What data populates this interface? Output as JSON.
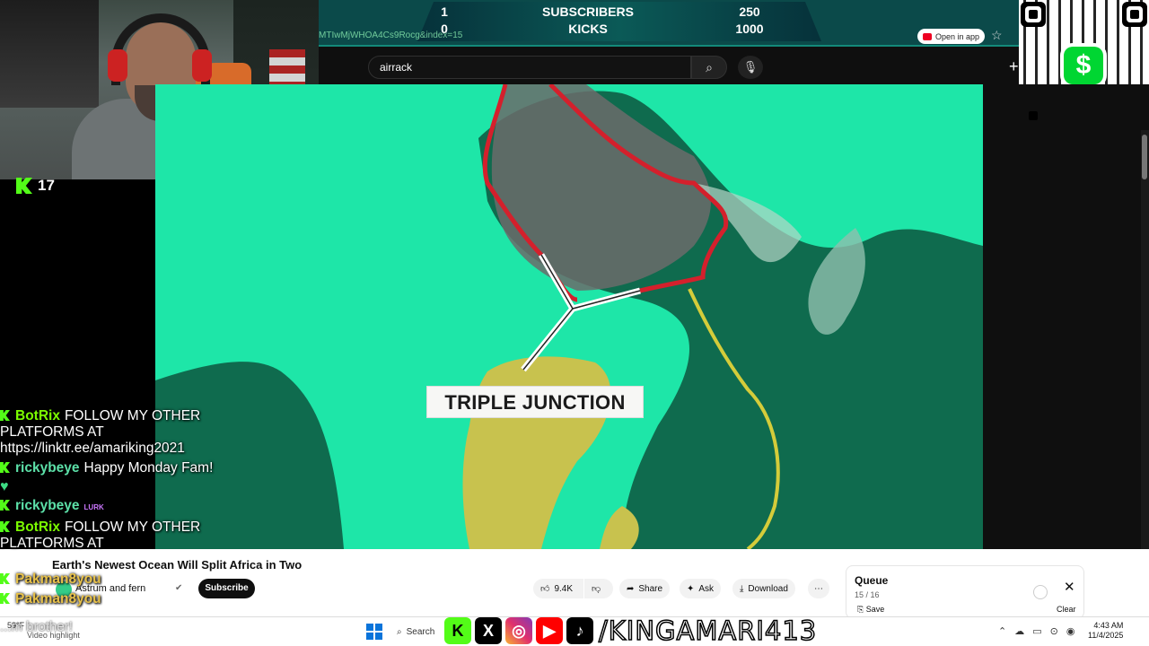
{
  "stream": {
    "kick_viewers": "17"
  },
  "goals": {
    "url_fragment": "MTIwMjWHOA4Cs9Rocg&index=15",
    "rows": [
      {
        "current": "1",
        "name": "SUBSCRIBERS",
        "target": "250"
      },
      {
        "current": "0",
        "name": "KICKS",
        "target": "1000"
      }
    ]
  },
  "browser": {
    "open_in_app": "Open in app"
  },
  "youtube": {
    "search_value": "airrack",
    "video_label": "TRIPLE JUNCTION",
    "video_title": "Earth's Newest Ocean Will Split Africa in Two",
    "channel": "Astrum and fern",
    "subscribe": "Subscribe",
    "likes": "9.4K",
    "share": "Share",
    "ask": "Ask",
    "download": "Download",
    "queue": {
      "title": "Queue",
      "count": "15 / 16",
      "save": "Save",
      "clear": "Clear"
    }
  },
  "chat": {
    "messages": [
      {
        "user": "BotRix",
        "text": "FOLLOW MY OTHER PLATFORMS AT https://linktr.ee/amariking2021"
      },
      {
        "user": "rickybeye",
        "text": "Happy Monday Fam!"
      },
      {
        "user": "rickybeye",
        "text": ""
      },
      {
        "user": "BotRix",
        "text": "FOLLOW MY OTHER PLATFORMS AT"
      },
      {
        "user": "Pakman8you",
        "text": ""
      },
      {
        "user": "Pakman8you",
        "text": ""
      }
    ],
    "trailing": "...m brother!"
  },
  "taskbar": {
    "weather": "59°F",
    "weather_sub": "Video highlight",
    "search": "Search",
    "time": "4:43 AM",
    "date": "11/4/2025"
  },
  "social": {
    "handle": "/KINGAMARI413"
  },
  "colors": {
    "kick_green": "#53fc18",
    "goal_panel": "#0b4a4a",
    "ocean": "#1ee6a8",
    "land_dark": "#0f6b4e",
    "rift_red": "#d4202c",
    "rift_yellow": "#d4cc3a"
  }
}
